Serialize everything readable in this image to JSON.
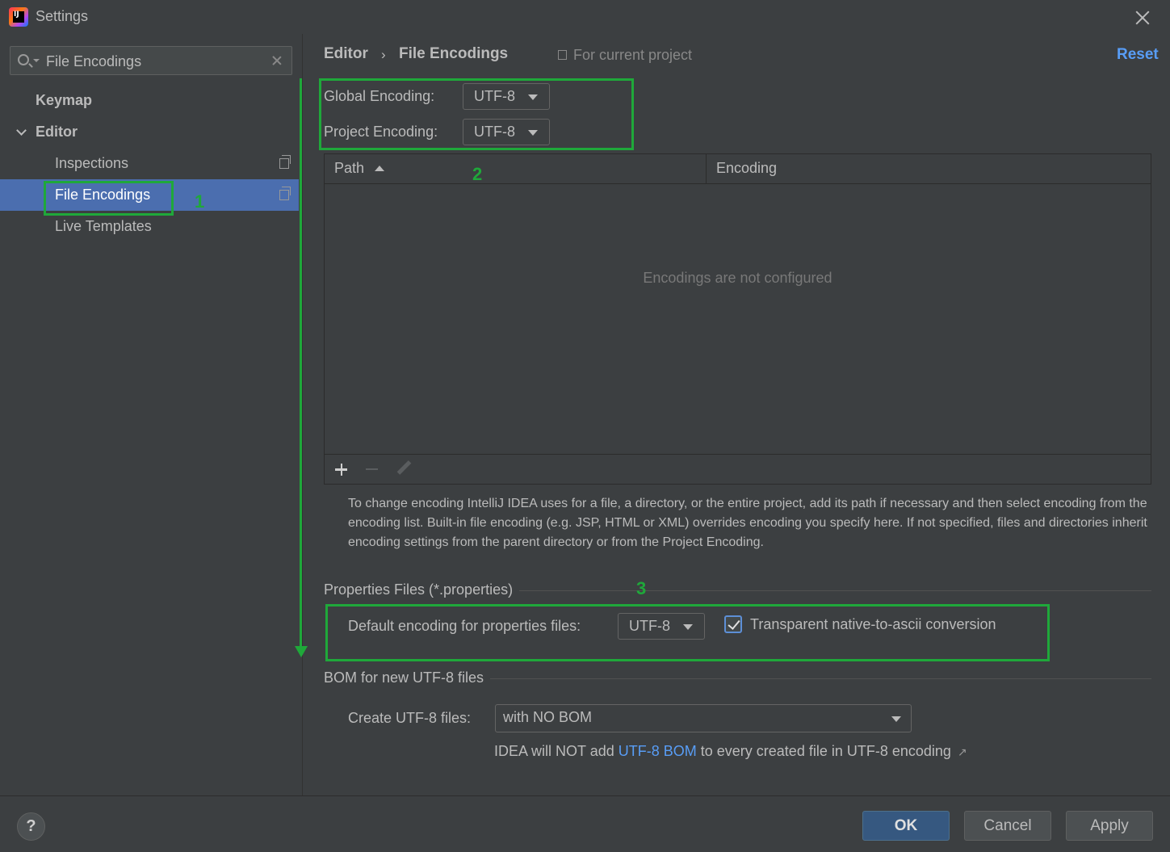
{
  "window": {
    "title": "Settings",
    "app_icon_text": "IJ"
  },
  "search": {
    "value": "File Encodings"
  },
  "sidebar": {
    "items": [
      {
        "label": "Keymap"
      },
      {
        "label": "Editor"
      },
      {
        "label": "Inspections"
      },
      {
        "label": "File Encodings"
      },
      {
        "label": "Live Templates"
      }
    ]
  },
  "breadcrumb": {
    "parent": "Editor",
    "separator": "›",
    "current": "File Encodings",
    "scope": "For current project",
    "reset": "Reset"
  },
  "encodings": {
    "global_label": "Global Encoding:",
    "global_value": "UTF-8",
    "project_label": "Project Encoding:",
    "project_value": "UTF-8"
  },
  "table": {
    "columns": [
      "Path",
      "Encoding"
    ],
    "empty_text": "Encodings are not configured",
    "toolbar": [
      "add",
      "remove",
      "edit"
    ]
  },
  "help_text": "To change encoding IntelliJ IDEA uses for a file, a directory, or the entire project, add its path if necessary and then select encoding from the encoding list. Built-in file encoding (e.g. JSP, HTML or XML) overrides encoding you specify here. If not specified, files and directories inherit encoding settings from the parent directory or from the Project Encoding.",
  "properties": {
    "section_title": "Properties Files (*.properties)",
    "default_label": "Default encoding for properties files:",
    "default_value": "UTF-8",
    "transparent_label": "Transparent native-to-ascii conversion",
    "transparent_checked": true
  },
  "bom": {
    "section_title": "BOM for new UTF-8 files",
    "create_label": "Create UTF-8 files:",
    "create_value": "with NO BOM",
    "note_prefix": "IDEA will NOT add",
    "note_link": "UTF-8 BOM",
    "note_suffix": "to every created file in UTF-8 encoding",
    "ext_icon": "↗"
  },
  "footer": {
    "help": "?",
    "ok": "OK",
    "cancel": "Cancel",
    "apply": "Apply"
  },
  "annotations": {
    "one": "1",
    "two": "2",
    "three": "3",
    "color": "#1fa83a"
  },
  "colors": {
    "selection": "#4b6eaf",
    "link": "#589df6",
    "background": "#3c3f41"
  }
}
